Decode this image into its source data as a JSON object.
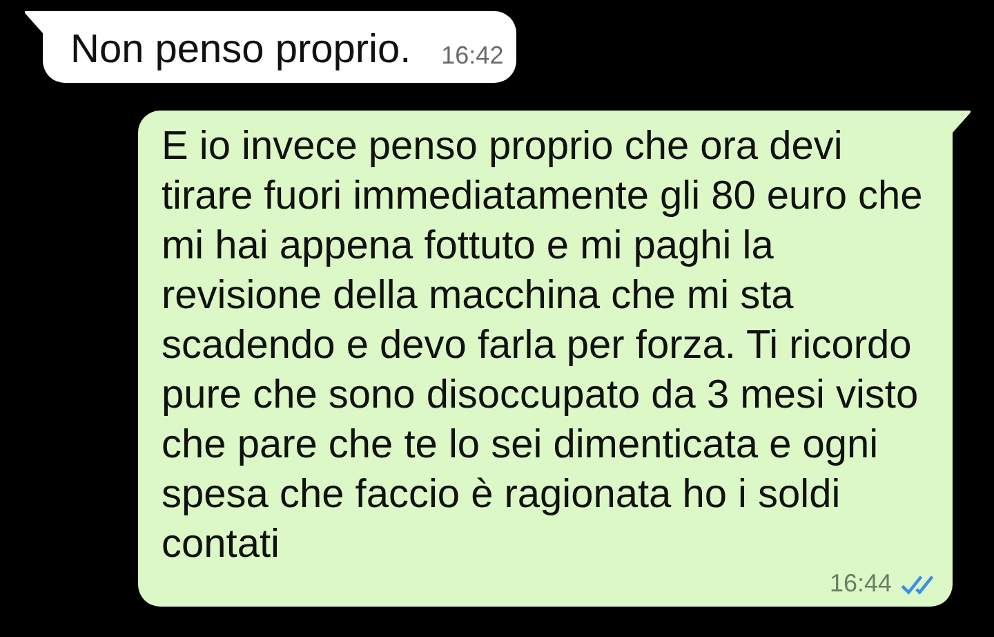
{
  "messages": [
    {
      "kind": "incoming",
      "text": "Non penso proprio.",
      "time": "16:42"
    },
    {
      "kind": "outgoing",
      "text": "E io invece penso proprio che ora devi tirare fuori immediatamente gli 80 euro che mi hai appena fottuto e mi paghi la revisione della macchina che mi sta scadendo e devo farla per forza. Ti ricordo pure che sono disoccupato da 3 mesi visto che pare che te lo sei dimenticata e ogni spesa che faccio è ragionata ho i soldi contati",
      "time": "16:44",
      "read": true
    }
  ]
}
